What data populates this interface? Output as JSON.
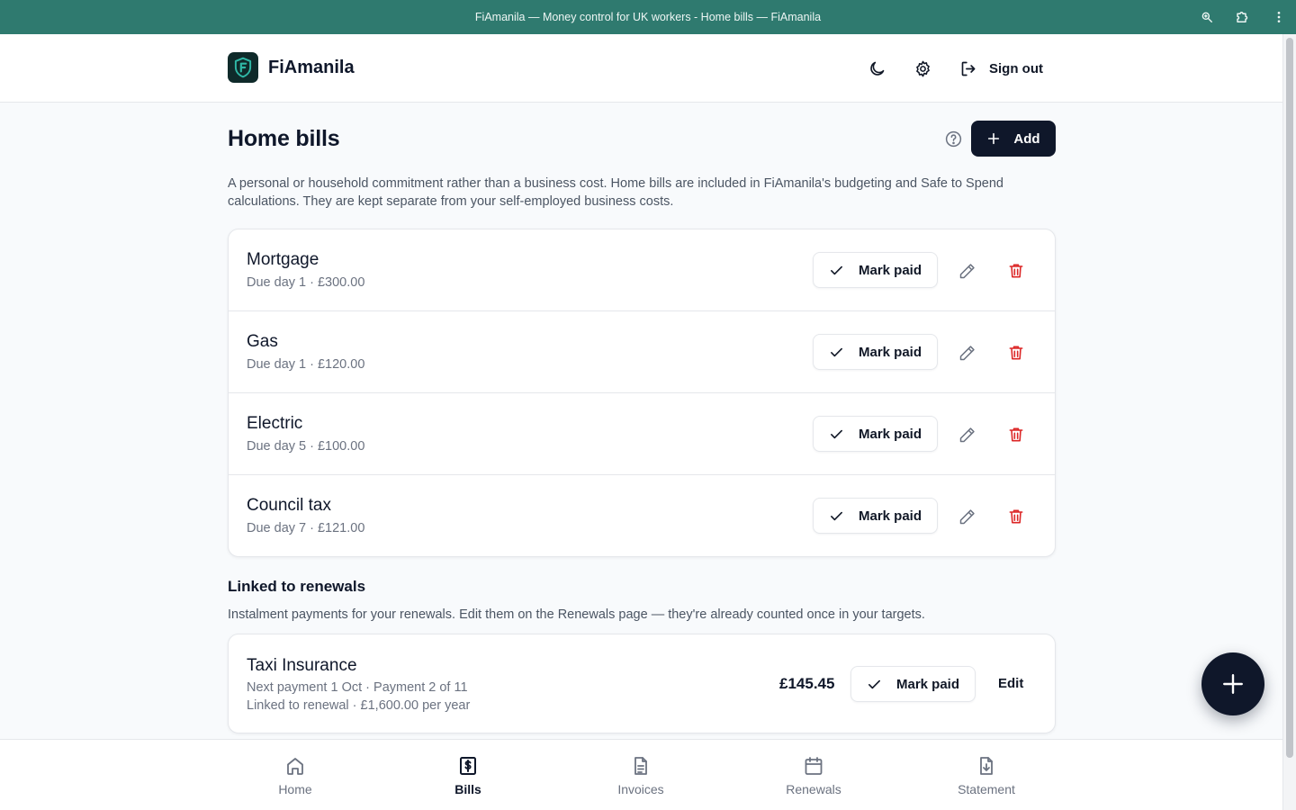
{
  "browser": {
    "title": "FiAmanila — Money control for UK workers - Home bills — FiAmanila"
  },
  "header": {
    "brand": "FiAmanila",
    "sign_out_label": "Sign out"
  },
  "page": {
    "title": "Home bills",
    "add_label": "Add",
    "description": "A personal or household commitment rather than a business cost. Home bills are included in FiAmanila's budgeting and Safe to Spend calculations. They are kept separate from your self-employed business costs."
  },
  "bills": [
    {
      "name": "Mortgage",
      "meta": "Due day 1 · £300.00",
      "mark_paid": "Mark paid"
    },
    {
      "name": "Gas",
      "meta": "Due day 1 · £120.00",
      "mark_paid": "Mark paid"
    },
    {
      "name": "Electric",
      "meta": "Due day 5 · £100.00",
      "mark_paid": "Mark paid"
    },
    {
      "name": "Council tax",
      "meta": "Due day 7 · £121.00",
      "mark_paid": "Mark paid"
    }
  ],
  "linked": {
    "title": "Linked to renewals",
    "description": "Instalment payments for your renewals. Edit them on the Renewals page — they're already counted once in your targets.",
    "item": {
      "name": "Taxi Insurance",
      "meta1": "Next payment 1 Oct · Payment 2 of 11",
      "meta2": "Linked to renewal · £1,600.00 per year",
      "amount": "£145.45",
      "mark_paid": "Mark paid",
      "edit_label": "Edit"
    }
  },
  "nav": {
    "items": [
      {
        "label": "Home",
        "icon": "home-icon"
      },
      {
        "label": "Bills",
        "icon": "bills-icon",
        "active": true
      },
      {
        "label": "Invoices",
        "icon": "invoice-icon"
      },
      {
        "label": "Renewals",
        "icon": "calendar-icon"
      },
      {
        "label": "Statement",
        "icon": "statement-download-icon"
      }
    ]
  },
  "colors": {
    "titlebar": "#2f7a6f",
    "primary": "#0f172a",
    "danger": "#dc2626",
    "muted": "#6b7280",
    "brand_accent": "#2fb8a6"
  }
}
